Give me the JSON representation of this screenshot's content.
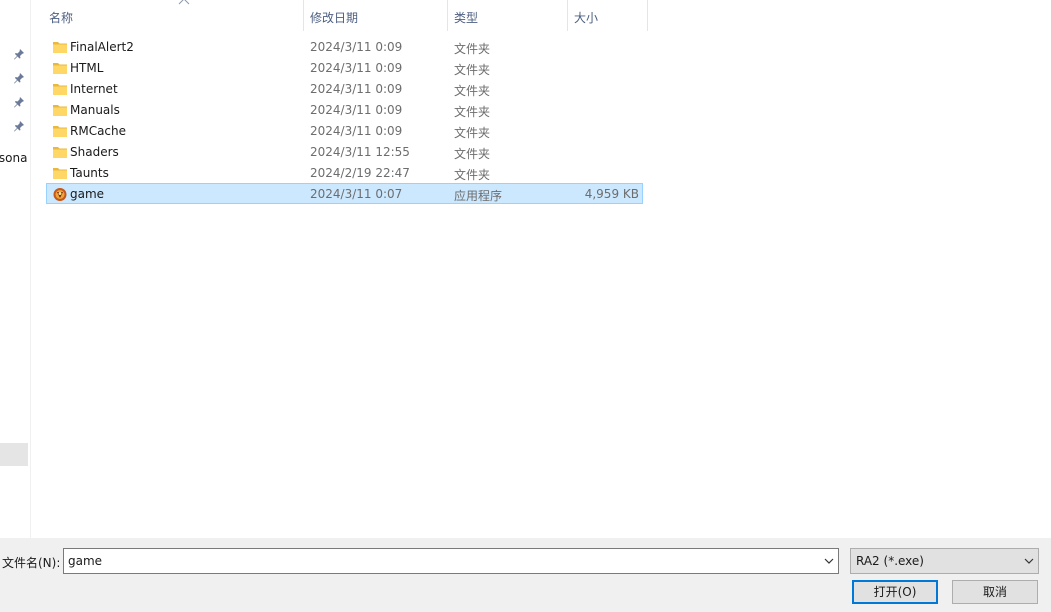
{
  "nav": {
    "pinned_count": 4,
    "partial_label": "rsona"
  },
  "columns": {
    "name": "名称",
    "date": "修改日期",
    "type": "类型",
    "size": "大小"
  },
  "files": [
    {
      "name": "FinalAlert2",
      "date": "2024/3/11 0:09",
      "type": "文件夹",
      "size": "",
      "icon": "folder-icon"
    },
    {
      "name": "HTML",
      "date": "2024/3/11 0:09",
      "type": "文件夹",
      "size": "",
      "icon": "folder-icon"
    },
    {
      "name": "Internet",
      "date": "2024/3/11 0:09",
      "type": "文件夹",
      "size": "",
      "icon": "folder-icon"
    },
    {
      "name": "Manuals",
      "date": "2024/3/11 0:09",
      "type": "文件夹",
      "size": "",
      "icon": "folder-icon"
    },
    {
      "name": "RMCache",
      "date": "2024/3/11 0:09",
      "type": "文件夹",
      "size": "",
      "icon": "folder-icon"
    },
    {
      "name": "Shaders",
      "date": "2024/3/11 12:55",
      "type": "文件夹",
      "size": "",
      "icon": "folder-icon"
    },
    {
      "name": "Taunts",
      "date": "2024/2/19 22:47",
      "type": "文件夹",
      "size": "",
      "icon": "folder-icon"
    },
    {
      "name": "game",
      "date": "2024/3/11 0:07",
      "type": "应用程序",
      "size": "4,959 KB",
      "icon": "game-app-icon",
      "selected": true
    }
  ],
  "footer": {
    "filename_label": "文件名(N):",
    "filename_value": "game",
    "filetype_label": "RA2 (*.exe)",
    "open_label": "打开(O)",
    "cancel_label": "取消"
  },
  "colors": {
    "selection_bg": "#cce8ff",
    "selection_border": "#99d1ff",
    "header_text": "#4d6082",
    "focus_border": "#0078d7",
    "folder_yellow": "#ffd766"
  }
}
